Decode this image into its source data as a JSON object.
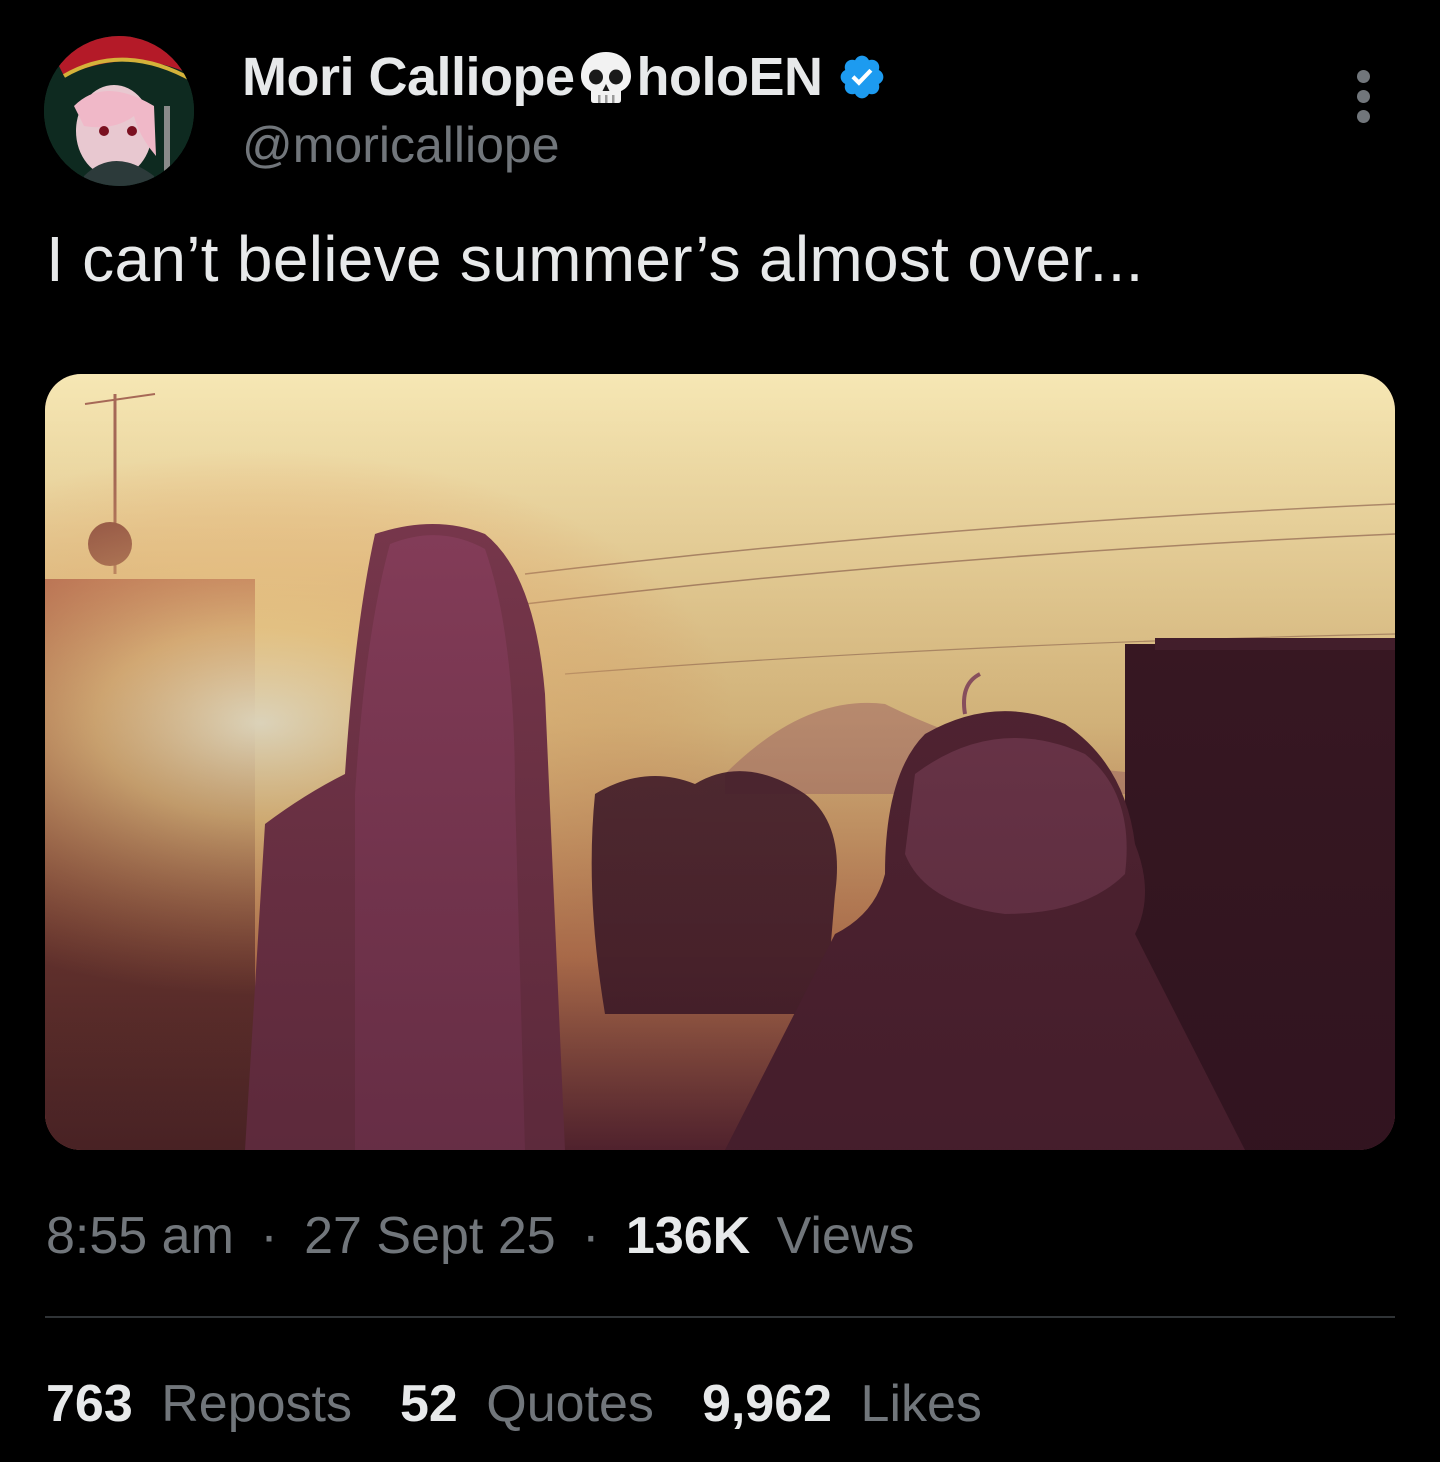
{
  "tweet": {
    "display_name": "Mori Calliope",
    "name_suffix": "holoEN",
    "handle": "@moricalliope",
    "text": "I can’t believe summer’s almost over...",
    "media_description_icon": "photo",
    "time": "8:55 am",
    "separator": "·",
    "date": "27 Sept 25",
    "views_count": "136K",
    "views_label": "Views"
  },
  "icons": {
    "skull": "skull-icon",
    "verified": "verified-badge-icon",
    "more": "more-options-icon"
  },
  "stats": [
    {
      "count": "763",
      "label": "Reposts"
    },
    {
      "count": "52",
      "label": "Quotes"
    },
    {
      "count": "9,962",
      "label": "Likes"
    }
  ],
  "colors": {
    "background": "#000000",
    "primary_text": "#e7e9ea",
    "secondary_text": "#71767b",
    "verified": "#1d9bf0",
    "divider": "#2f3336"
  }
}
